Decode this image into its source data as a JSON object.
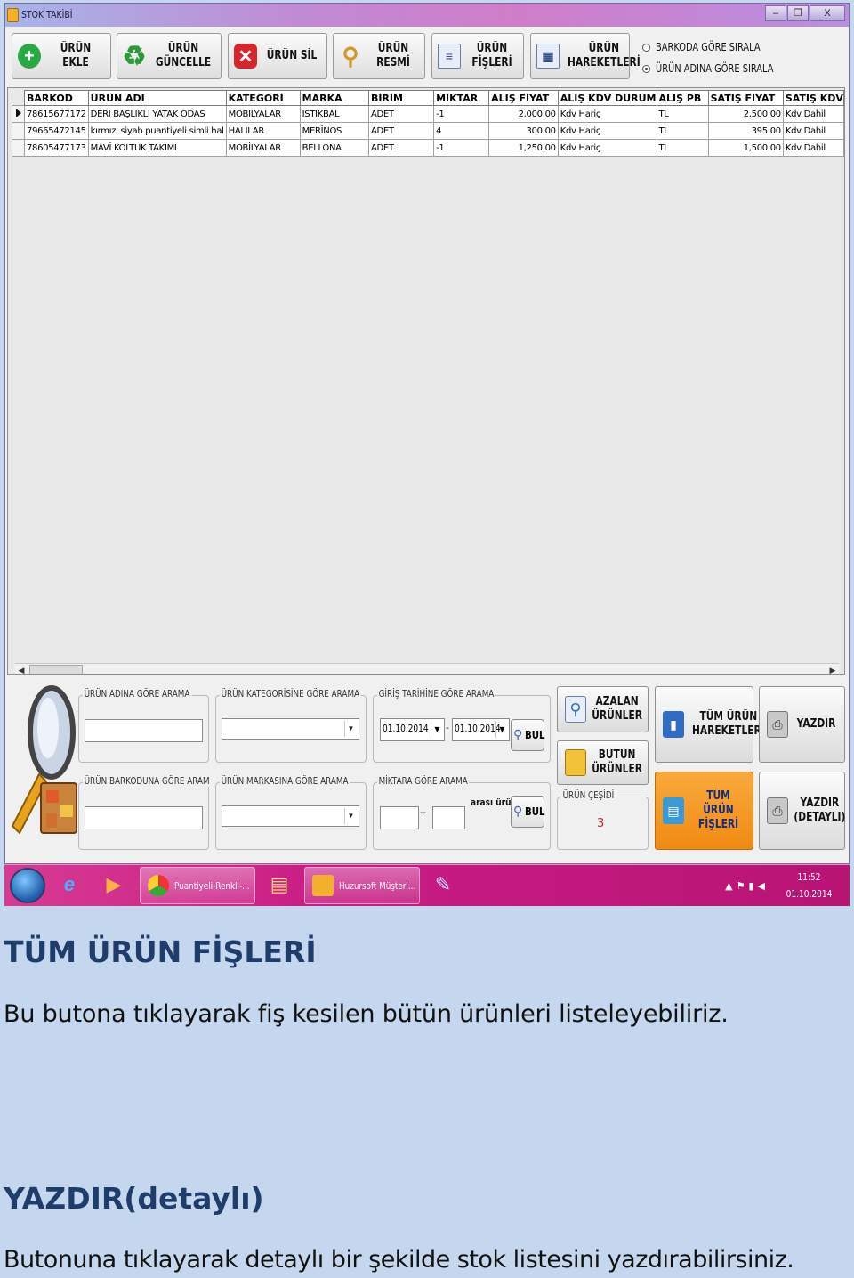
{
  "window": {
    "title": "STOK TAKİBİ",
    "controls": {
      "minimize": "‒",
      "maximize": "❐",
      "close": "X"
    }
  },
  "toolbar": {
    "urun_ekle": "ÜRÜN EKLE",
    "urun_guncelle_1": "ÜRÜN",
    "urun_guncelle_2": "GÜNCELLE",
    "urun_sil": "ÜRÜN SİL",
    "urun_resmi": "ÜRÜN RESMİ",
    "urun_fisleri_1": "ÜRÜN",
    "urun_fisleri_2": "FİŞLERİ",
    "urun_hareketleri_1": "ÜRÜN",
    "urun_hareketleri_2": "HAREKETLERİ"
  },
  "sort": {
    "barkod": "BARKODA GÖRE SIRALA",
    "ad": "ÜRÜN ADINA GÖRE SIRALA",
    "selected": "ad"
  },
  "table": {
    "columns": [
      "BARKOD",
      "ÜRÜN ADI",
      "KATEGORİ",
      "MARKA",
      "BİRİM",
      "MİKTAR",
      "ALIŞ FİYAT",
      "ALIŞ KDV DURUM",
      "ALIŞ PB",
      "SATIŞ FİYAT",
      "SATIŞ KDV"
    ],
    "rows": [
      [
        "78615677172",
        "DERİ BAŞLIKLI YATAK ODAS",
        "MOBİLYALAR",
        "İSTİKBAL",
        "ADET",
        "-1",
        "2,000.00",
        "Kdv Hariç",
        "TL",
        "2,500.00",
        "Kdv Dahil"
      ],
      [
        "79665472145",
        "kırmızı siyah puantiyeli simli hal",
        "HALILAR",
        "MERİNOS",
        "ADET",
        "4",
        "300.00",
        "Kdv Hariç",
        "TL",
        "395.00",
        "Kdv Dahil"
      ],
      [
        "78605477173",
        "MAVİ KOLTUK TAKIMI",
        "MOBİLYALAR",
        "BELLONA",
        "ADET",
        "-1",
        "1,250.00",
        "Kdv Hariç",
        "TL",
        "1,500.00",
        "Kdv Dahil"
      ]
    ]
  },
  "search": {
    "ad_legend": "ÜRÜN ADINA GÖRE ARAMA",
    "kategori_legend": "ÜRÜN KATEGORİSİNE GÖRE ARAMA",
    "tarih_legend": "GİRİŞ TARİHİNE GÖRE ARAMA",
    "barkod_legend": "ÜRÜN BARKODUNA GÖRE ARAM",
    "marka_legend": "ÜRÜN MARKASINA GÖRE ARAMA",
    "miktar_legend": "MİKTARA GÖRE ARAMA",
    "date_from": "01.10.2014",
    "date_to": "01.10.2014",
    "date_sep": "-",
    "miktar_sep": "--",
    "arasi": "arası ürün",
    "bul": "BUL"
  },
  "cesit": {
    "legend": "ÜRÜN ÇEŞİDİ",
    "value": "3"
  },
  "actions": {
    "azalan_1": "AZALAN",
    "azalan_2": "ÜRÜNLER",
    "butun_1": "BÜTÜN",
    "butun_2": "ÜRÜNLER",
    "tum_hareket_1": "TÜM ÜRÜN",
    "tum_hareket_2": "HAREKETLERİ",
    "tum_fis_1": "TÜM ÜRÜN",
    "tum_fis_2": "FİŞLERİ",
    "yazdir": "YAZDIR",
    "yazdir_detay_1": "YAZDIR",
    "yazdir_detay_2": "(DETAYLI)"
  },
  "taskbar": {
    "chrome": "Puantiyeli-Renkli-...",
    "huzursoft": "Huzursoft Müşteri...",
    "time": "11:52",
    "date": "01.10.2014"
  },
  "doc": {
    "h1": "TÜM ÜRÜN FİŞLERİ",
    "p1": "Bu butona tıklayarak fiş kesilen bütün ürünleri listeleyebiliriz.",
    "h2": "YAZDIR(detaylı)",
    "p2": "Butonuna tıklayarak detaylı bir şekilde stok listesini yazdırabilirsiniz."
  }
}
